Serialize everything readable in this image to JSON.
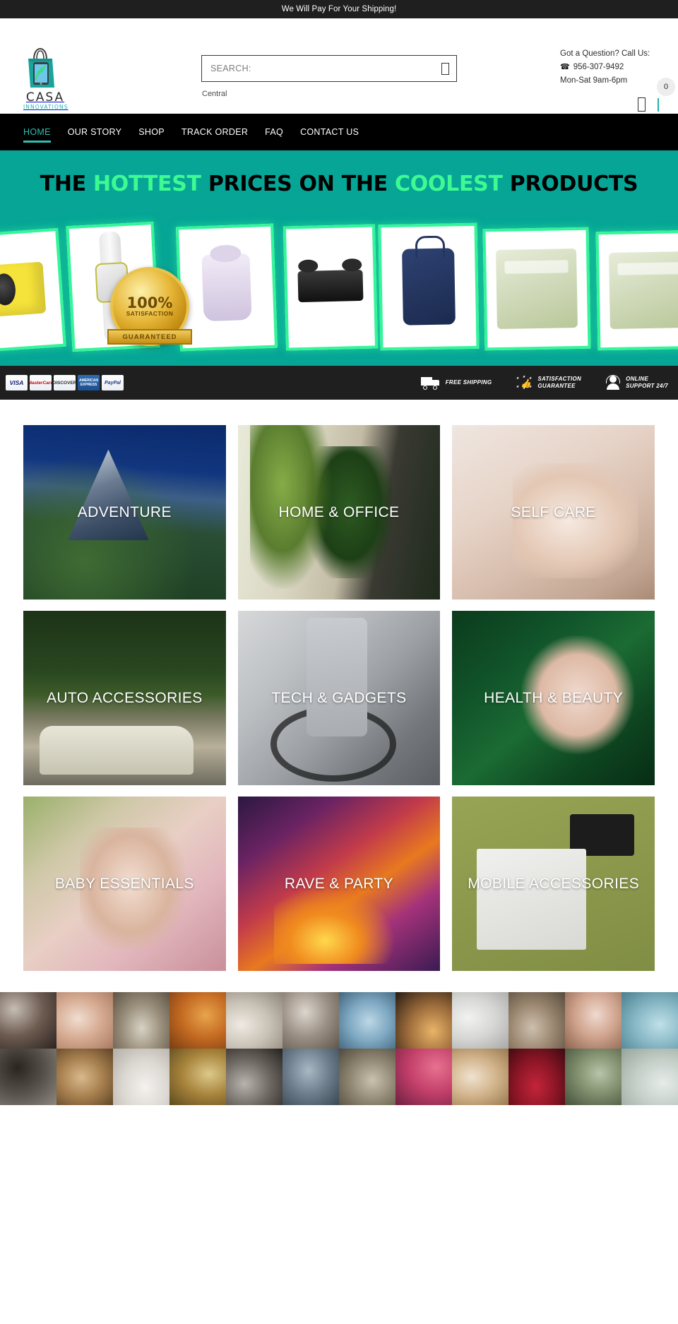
{
  "announcement": {
    "text": "We Will Pay For Your Shipping!"
  },
  "brand": {
    "name": "CASA",
    "tagline": "INNOVATIONS",
    "logo_icon": "shopping-bag-with-phone-icon",
    "logo_color": "#1fb0ae"
  },
  "search": {
    "placeholder": "SEARCH:",
    "value": "",
    "icon": "search-icon",
    "sub_label": "Central"
  },
  "contact": {
    "question": "Got a Question? Call Us:",
    "phone": "956-307-9492",
    "phone_icon": "phone-icon",
    "hours": "Mon-Sat 9am-6pm"
  },
  "account": {
    "user_icon": "user-account-icon",
    "cart_icon": "shopping-cart-icon",
    "cart_count": "0"
  },
  "nav": {
    "items": [
      {
        "label": "HOME",
        "active": true
      },
      {
        "label": "OUR STORY",
        "active": false
      },
      {
        "label": "SHOP",
        "active": false
      },
      {
        "label": "TRACK ORDER",
        "active": false
      },
      {
        "label": "FAQ",
        "active": false
      },
      {
        "label": "CONTACT US",
        "active": false
      }
    ],
    "active_color": "#2fbfae",
    "background": "#000000"
  },
  "hero": {
    "headline_part1": "THE ",
    "headline_hl1": "HOTTEST",
    "headline_part2": " PRICES ON THE ",
    "headline_hl2": "COOLEST",
    "headline_part3": " PRODUCTS",
    "background_color": "#06a596",
    "highlight_color": "#3dfb92",
    "slides": [
      {
        "name": "mini-projector"
      },
      {
        "name": "sport-smartwatch"
      },
      {
        "name": "pro-wax-warmer"
      },
      {
        "name": "foldable-selfie-drone"
      },
      {
        "name": "navy-diaper-backpack"
      },
      {
        "name": "bubble-clay-mask"
      },
      {
        "name": "skincare-product"
      }
    ],
    "badge": {
      "percent": "100%",
      "line1": "SATISFACTION",
      "ribbon": "GUARANTEED"
    }
  },
  "trust_bar": {
    "background": "#1f1f1f",
    "payment_methods": [
      {
        "label": "VISA",
        "name": "visa-card-icon"
      },
      {
        "label": "MasterCard",
        "name": "mastercard-icon"
      },
      {
        "label": "DISCOVER",
        "name": "discover-card-icon"
      },
      {
        "label": "AMERICAN EXPRESS",
        "name": "amex-card-icon"
      },
      {
        "label": "PayPal",
        "name": "paypal-icon"
      }
    ],
    "features": [
      {
        "icon": "delivery-truck-icon",
        "line1": "FREE SHIPPING",
        "line2": ""
      },
      {
        "icon": "thumbs-up-stars-icon",
        "line1": "SATISFACTION",
        "line2": "GUARANTEE"
      },
      {
        "icon": "headset-support-icon",
        "line1": "ONLINE",
        "line2": "SUPPORT 24/7"
      }
    ]
  },
  "categories": [
    {
      "label": "ADVENTURE",
      "bg": "bg-adventure"
    },
    {
      "label": "HOME & OFFICE",
      "bg": "bg-home"
    },
    {
      "label": "SELF CARE",
      "bg": "bg-self"
    },
    {
      "label": "AUTO ACCESSORIES",
      "bg": "bg-auto"
    },
    {
      "label": "TECH & GADGETS",
      "bg": "bg-tech"
    },
    {
      "label": "HEALTH & BEAUTY",
      "bg": "bg-health"
    },
    {
      "label": "BABY ESSENTIALS",
      "bg": "bg-baby"
    },
    {
      "label": "RAVE & PARTY",
      "bg": "bg-rave"
    },
    {
      "label": "MOBILE ACCESSORIES",
      "bg": "bg-mobile"
    }
  ],
  "gallery": {
    "rows": 2,
    "columns": 12,
    "cells": [
      "woman-dark-hair-portrait",
      "woman-laughing-hands-face",
      "blonde-woman-plaid-shirt",
      "woman-autumn-leaves",
      "white-dress-legs-walking",
      "woman-holding-phone",
      "woman-jumping-beach-sunset",
      "silhouette-person-sunset",
      "white-round-device",
      "hands-holding-object",
      "woman-smiling-closeup",
      "beach-water-texture",
      "woman-long-black-hair",
      "couple-hugging-palm-tree",
      "white-lace-dress-detail",
      "woman-holding-flowers",
      "woman-black-outfit-street",
      "person-blue-shirt-back",
      "woman-with-backpack-field",
      "woman-pink-smoke-flare",
      "blonde-woman-portrait",
      "woman-red-roses",
      "person-outdoors",
      "beach-sand-texture"
    ]
  }
}
